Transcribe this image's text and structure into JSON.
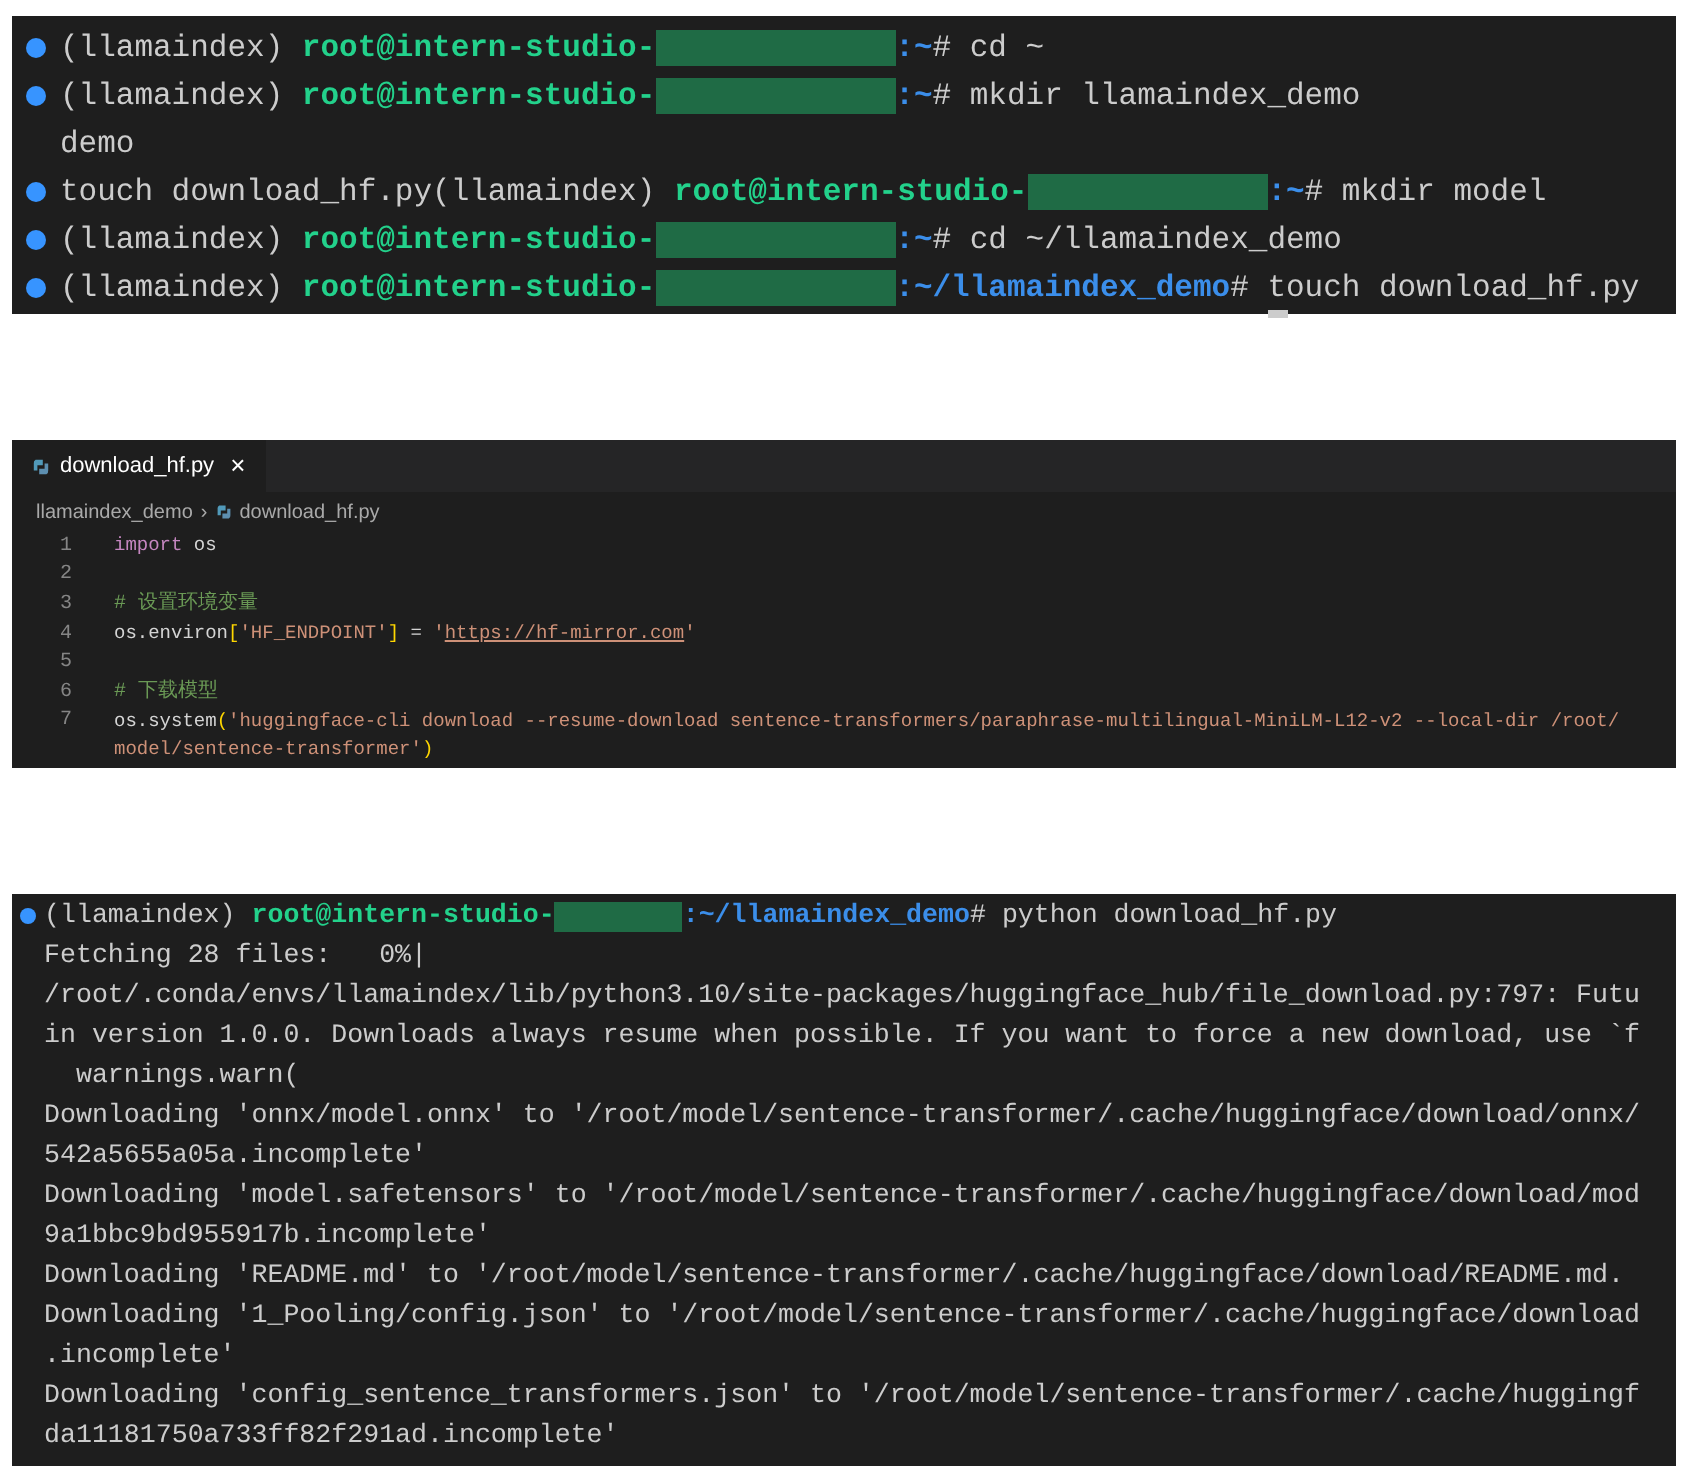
{
  "terminal_top": {
    "lines": [
      {
        "kind": "prompt",
        "env": "(llamaindex) ",
        "user": "root@intern-studio-",
        "path": ":~",
        "command": "# cd ~"
      },
      {
        "kind": "prompt",
        "env": "(llamaindex) ",
        "user": "root@intern-studio-",
        "path": ":~",
        "command": "# mkdir llamaindex_demo"
      },
      {
        "kind": "output",
        "text": "demo"
      },
      {
        "kind": "prompt",
        "lead": "touch download_hf.py",
        "env": "(llamaindex) ",
        "user": "root@intern-studio-",
        "path": ":~",
        "command": "# mkdir model"
      },
      {
        "kind": "prompt",
        "env": "(llamaindex) ",
        "user": "root@intern-studio-",
        "path": ":~",
        "command": "# cd ~/llamaindex_demo"
      },
      {
        "kind": "prompt",
        "env": "(llamaindex) ",
        "user": "root@intern-studio-",
        "path": ":~/llamaindex_demo",
        "command": "# touch download_hf.py",
        "cursor": true
      }
    ]
  },
  "editor": {
    "tabs": [
      {
        "label": "download_hf.py",
        "selected": true,
        "close": "×"
      }
    ],
    "breadcrumb": {
      "folder": "llamaindex_demo",
      "separator": "›",
      "file": "download_hf.py"
    },
    "code_lines": [
      {
        "number": "1",
        "tokens": [
          {
            "kind": "keyword",
            "text": "import"
          },
          {
            "kind": "plain",
            "text": " os"
          }
        ]
      },
      {
        "number": "2"
      },
      {
        "number": "3",
        "tokens": [
          {
            "kind": "comment",
            "text": "# 设置环境变量"
          }
        ]
      },
      {
        "number": "4",
        "tokens": [
          {
            "kind": "plain",
            "text": "os.environ"
          },
          {
            "kind": "bracket",
            "text": "["
          },
          {
            "kind": "string",
            "text": "'HF_ENDPOINT'"
          },
          {
            "kind": "bracket",
            "text": "]"
          },
          {
            "kind": "plain",
            "text": " = "
          },
          {
            "kind": "string",
            "text": "'"
          },
          {
            "kind": "link",
            "text": "https://hf-mirror.com"
          },
          {
            "kind": "string",
            "text": "'"
          }
        ]
      },
      {
        "number": "5"
      },
      {
        "number": "6",
        "tokens": [
          {
            "kind": "comment",
            "text": "# 下载模型"
          }
        ]
      },
      {
        "number": "7",
        "tokens": [
          {
            "kind": "plain",
            "text": "os.system"
          },
          {
            "kind": "bracket",
            "text": "("
          },
          {
            "kind": "string",
            "text": "'huggingface-cli download --resume-download sentence-transformers/paraphrase-multilingual-MiniLM-L12-v2 --local-dir /root/"
          }
        ]
      },
      {
        "tokens": [
          {
            "kind": "string",
            "text": "model/sentence-transformer'"
          },
          {
            "kind": "bracket",
            "text": ")"
          }
        ]
      }
    ]
  },
  "terminal_bottom": {
    "lines": [
      {
        "kind": "prompt",
        "env": "(llamaindex) ",
        "user": "root@intern-studio-",
        "path": ":~/llamaindex_demo",
        "command": "# python download_hf.py"
      },
      {
        "kind": "output",
        "text": "Fetching 28 files:   0%|"
      },
      {
        "kind": "output",
        "text": "/root/.conda/envs/llamaindex/lib/python3.10/site-packages/huggingface_hub/file_download.py:797: Futu"
      },
      {
        "kind": "output",
        "text": "in version 1.0.0. Downloads always resume when possible. If you want to force a new download, use `f"
      },
      {
        "kind": "output",
        "text": "  warnings.warn("
      },
      {
        "kind": "output",
        "text": "Downloading 'onnx/model.onnx' to '/root/model/sentence-transformer/.cache/huggingface/download/onnx/"
      },
      {
        "kind": "output",
        "text": "542a5655a05a.incomplete'"
      },
      {
        "kind": "output",
        "text": "Downloading 'model.safetensors' to '/root/model/sentence-transformer/.cache/huggingface/download/mod"
      },
      {
        "kind": "output",
        "text": "9a1bbc9bd955917b.incomplete'"
      },
      {
        "kind": "output",
        "text": "Downloading 'README.md' to '/root/model/sentence-transformer/.cache/huggingface/download/README.md."
      },
      {
        "kind": "output",
        "text": "Downloading '1_Pooling/config.json' to '/root/model/sentence-transformer/.cache/huggingface/download"
      },
      {
        "kind": "output",
        "text": ".incomplete'"
      },
      {
        "kind": "output",
        "text": "Downloading 'config_sentence_transformers.json' to '/root/model/sentence-transformer/.cache/huggingf"
      },
      {
        "kind": "output",
        "text": "da11181750a733ff82f291ad.incomplete'"
      }
    ]
  }
}
